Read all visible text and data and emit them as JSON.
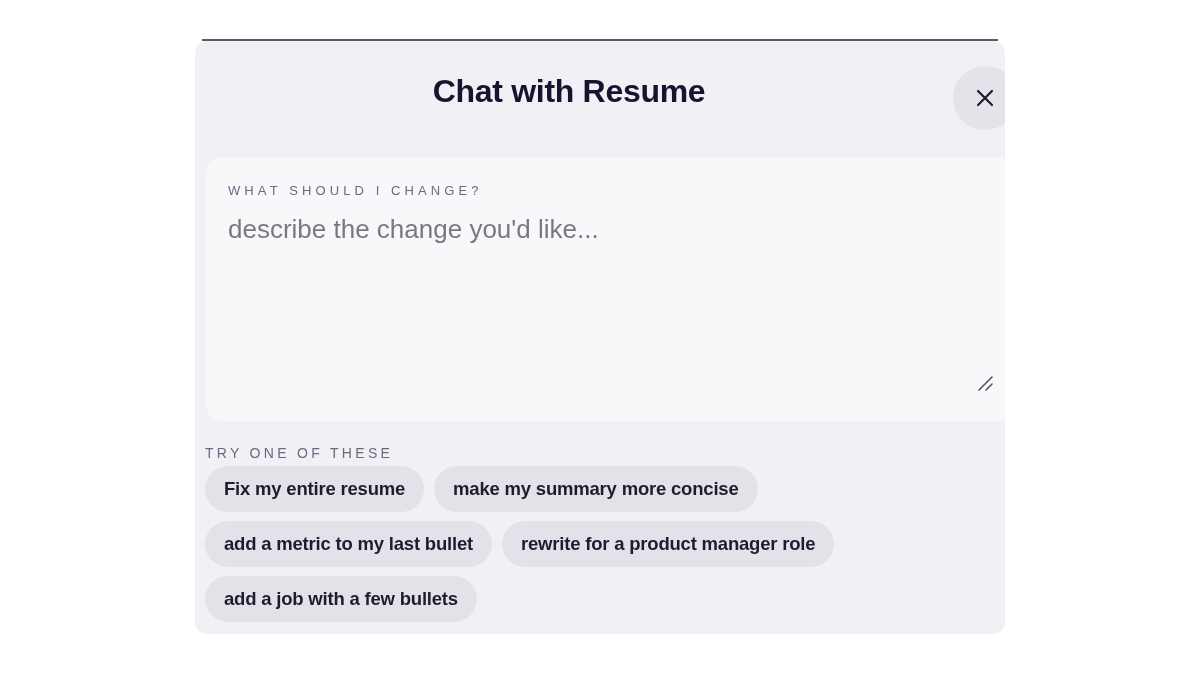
{
  "dialog": {
    "title": "Chat with Resume",
    "prompt": {
      "label": "WHAT SHOULD I CHANGE?",
      "placeholder": "describe the change you'd like..."
    },
    "suggestions": {
      "heading": "TRY ONE OF THESE",
      "items": [
        "Fix my entire resume",
        "make my summary more concise",
        "add a metric to my last bullet",
        "rewrite for a product manager role",
        "add a job with a few bullets"
      ]
    }
  }
}
